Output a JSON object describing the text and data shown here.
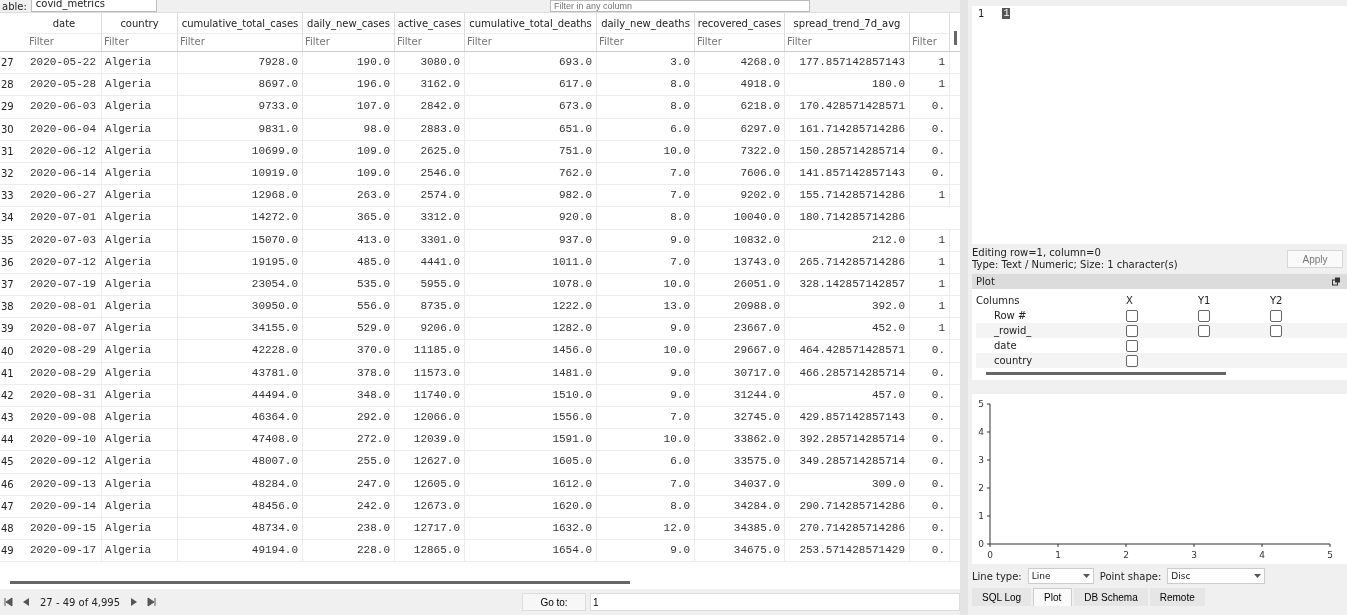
{
  "toolbar": {
    "table_label": "able:",
    "table_name": "covid_metrics",
    "filter_placeholder": "Filter in any column"
  },
  "table": {
    "columns": [
      "date",
      "country",
      "cumulative_total_cases",
      "daily_new_cases",
      "active_cases",
      "cumulative_total_deaths",
      "daily_new_deaths",
      "recovered_cases",
      "spread_trend_7d_avg",
      ""
    ],
    "filter_placeholders": [
      "Filter",
      "Filter",
      "Filter",
      "Filter",
      "Filter",
      "Filter",
      "Filter",
      "Filter",
      "Filter",
      "Filter"
    ],
    "rows": [
      {
        "num": "27",
        "cells": [
          "2020-05-22",
          "Algeria",
          "7928.0",
          "190.0",
          "3080.0",
          "693.0",
          "3.0",
          "4268.0",
          "177.857142857143",
          "1"
        ]
      },
      {
        "num": "28",
        "cells": [
          "2020-05-28",
          "Algeria",
          "8697.0",
          "196.0",
          "3162.0",
          "617.0",
          "8.0",
          "4918.0",
          "180.0",
          "1"
        ]
      },
      {
        "num": "29",
        "cells": [
          "2020-06-03",
          "Algeria",
          "9733.0",
          "107.0",
          "2842.0",
          "673.0",
          "8.0",
          "6218.0",
          "170.428571428571",
          "0."
        ]
      },
      {
        "num": "30",
        "cells": [
          "2020-06-04",
          "Algeria",
          "9831.0",
          "98.0",
          "2883.0",
          "651.0",
          "6.0",
          "6297.0",
          "161.714285714286",
          "0."
        ]
      },
      {
        "num": "31",
        "cells": [
          "2020-06-12",
          "Algeria",
          "10699.0",
          "109.0",
          "2625.0",
          "751.0",
          "10.0",
          "7322.0",
          "150.285714285714",
          "0."
        ]
      },
      {
        "num": "32",
        "cells": [
          "2020-06-14",
          "Algeria",
          "10919.0",
          "109.0",
          "2546.0",
          "762.0",
          "7.0",
          "7606.0",
          "141.857142857143",
          "0."
        ]
      },
      {
        "num": "33",
        "cells": [
          "2020-06-27",
          "Algeria",
          "12968.0",
          "263.0",
          "2574.0",
          "982.0",
          "7.0",
          "9202.0",
          "155.714285714286",
          "1"
        ]
      },
      {
        "num": "34",
        "cells": [
          "2020-07-01",
          "Algeria",
          "14272.0",
          "365.0",
          "3312.0",
          "920.0",
          "8.0",
          "10040.0",
          "180.714285714286"
        ]
      },
      {
        "num": "35",
        "cells": [
          "2020-07-03",
          "Algeria",
          "15070.0",
          "413.0",
          "3301.0",
          "937.0",
          "9.0",
          "10832.0",
          "212.0",
          "1"
        ]
      },
      {
        "num": "36",
        "cells": [
          "2020-07-12",
          "Algeria",
          "19195.0",
          "485.0",
          "4441.0",
          "1011.0",
          "7.0",
          "13743.0",
          "265.714285714286",
          "1"
        ]
      },
      {
        "num": "37",
        "cells": [
          "2020-07-19",
          "Algeria",
          "23054.0",
          "535.0",
          "5955.0",
          "1078.0",
          "10.0",
          "26051.0",
          "328.142857142857",
          "1"
        ]
      },
      {
        "num": "38",
        "cells": [
          "2020-08-01",
          "Algeria",
          "30950.0",
          "556.0",
          "8735.0",
          "1222.0",
          "13.0",
          "20988.0",
          "392.0",
          "1"
        ]
      },
      {
        "num": "39",
        "cells": [
          "2020-08-07",
          "Algeria",
          "34155.0",
          "529.0",
          "9206.0",
          "1282.0",
          "9.0",
          "23667.0",
          "452.0",
          "1"
        ]
      },
      {
        "num": "40",
        "cells": [
          "2020-08-29",
          "Algeria",
          "42228.0",
          "370.0",
          "11185.0",
          "1456.0",
          "10.0",
          "29667.0",
          "464.428571428571",
          "0."
        ]
      },
      {
        "num": "41",
        "cells": [
          "2020-08-29",
          "Algeria",
          "43781.0",
          "378.0",
          "11573.0",
          "1481.0",
          "9.0",
          "30717.0",
          "466.285714285714",
          "0."
        ]
      },
      {
        "num": "42",
        "cells": [
          "2020-08-31",
          "Algeria",
          "44494.0",
          "348.0",
          "11740.0",
          "1510.0",
          "9.0",
          "31244.0",
          "457.0",
          "0."
        ]
      },
      {
        "num": "43",
        "cells": [
          "2020-09-08",
          "Algeria",
          "46364.0",
          "292.0",
          "12066.0",
          "1556.0",
          "7.0",
          "32745.0",
          "429.857142857143",
          "0."
        ]
      },
      {
        "num": "44",
        "cells": [
          "2020-09-10",
          "Algeria",
          "47408.0",
          "272.0",
          "12039.0",
          "1591.0",
          "10.0",
          "33862.0",
          "392.285714285714",
          "0."
        ]
      },
      {
        "num": "45",
        "cells": [
          "2020-09-12",
          "Algeria",
          "48007.0",
          "255.0",
          "12627.0",
          "1605.0",
          "6.0",
          "33575.0",
          "349.285714285714",
          "0."
        ]
      },
      {
        "num": "46",
        "cells": [
          "2020-09-13",
          "Algeria",
          "48284.0",
          "247.0",
          "12605.0",
          "1612.0",
          "7.0",
          "34037.0",
          "309.0",
          "0."
        ]
      },
      {
        "num": "47",
        "cells": [
          "2020-09-14",
          "Algeria",
          "48456.0",
          "242.0",
          "12673.0",
          "1620.0",
          "8.0",
          "34284.0",
          "290.714285714286",
          "0."
        ]
      },
      {
        "num": "48",
        "cells": [
          "2020-09-15",
          "Algeria",
          "48734.0",
          "238.0",
          "12717.0",
          "1632.0",
          "12.0",
          "34385.0",
          "270.714285714286",
          "0."
        ]
      },
      {
        "num": "49",
        "cells": [
          "2020-09-17",
          "Algeria",
          "49194.0",
          "228.0",
          "12865.0",
          "1654.0",
          "9.0",
          "34675.0",
          "253.571428571429",
          "0."
        ]
      }
    ]
  },
  "navigation": {
    "range": "27 - 49 of 4,995",
    "goto_label": "Go to:",
    "goto_value": "1"
  },
  "editor": {
    "line_number": "1",
    "value": "1",
    "status_line_1": "Editing row=1, column=0",
    "status_line_2": "Type: Text / Numeric; Size: 1 character(s)",
    "apply_button": "Apply"
  },
  "plot": {
    "title": "Plot",
    "headers": [
      "Columns",
      "X",
      "Y1",
      "Y2"
    ],
    "columns": [
      {
        "name": "Row #",
        "x": false,
        "y1": false,
        "y2": false
      },
      {
        "name": "_rowid_",
        "x": false,
        "y1": false,
        "y2": false
      },
      {
        "name": "date",
        "x": false
      },
      {
        "name": "country",
        "x": false
      }
    ],
    "chart_data": {
      "type": "line",
      "xlim": [
        0,
        5
      ],
      "ylim": [
        0,
        5
      ],
      "xticks": [
        0,
        1,
        2,
        3,
        4,
        5
      ],
      "yticks": [
        0,
        1,
        2,
        3,
        4,
        5
      ]
    },
    "line_type_label": "Line type:",
    "line_type": "Line",
    "point_shape_label": "Point shape:",
    "point_shape": "Disc"
  },
  "tabs": [
    {
      "label": "SQL Log",
      "selected": false
    },
    {
      "label": "Plot",
      "selected": true
    },
    {
      "label": "DB Schema",
      "selected": false
    },
    {
      "label": "Remote",
      "selected": false
    }
  ]
}
